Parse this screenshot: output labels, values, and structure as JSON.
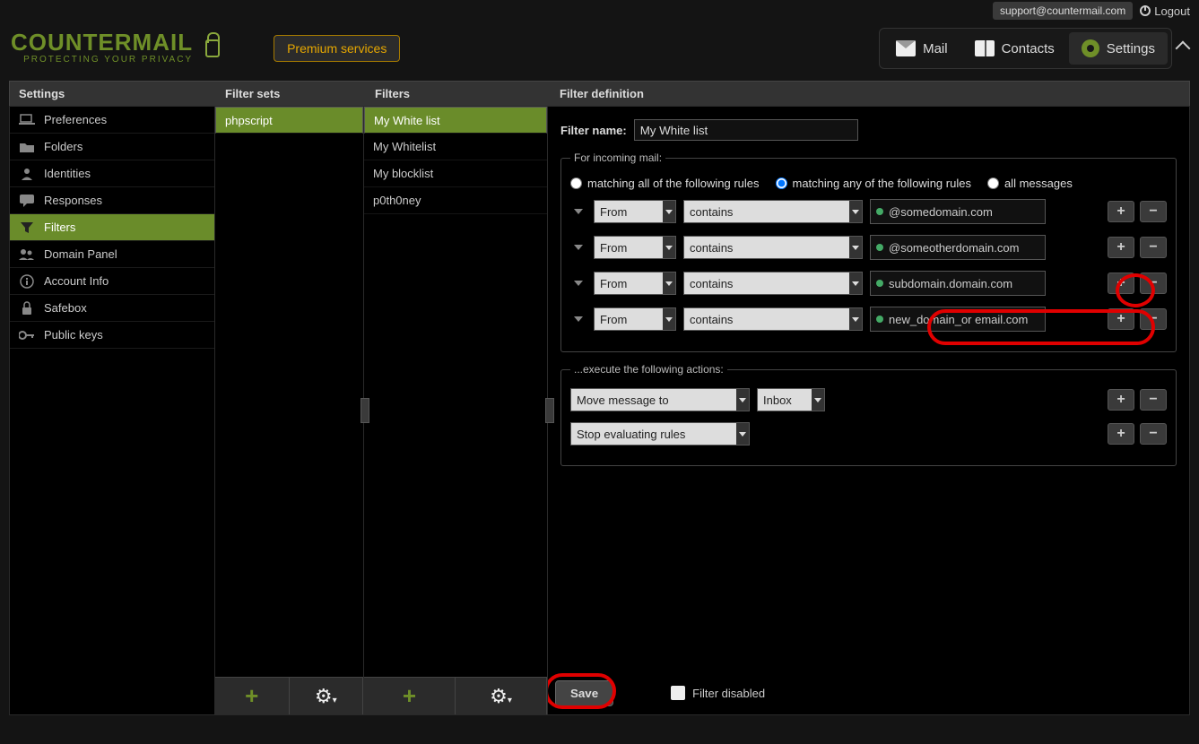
{
  "topbar": {
    "support": "support@countermail.com",
    "logout": "Logout"
  },
  "brand": {
    "name": "COUNTERMAIL",
    "tagline": "PROTECTING YOUR PRIVACY"
  },
  "premium_label": "Premium services",
  "tabs": {
    "mail": "Mail",
    "contacts": "Contacts",
    "settings": "Settings"
  },
  "columns": {
    "settings": "Settings",
    "filter_sets": "Filter sets",
    "filters": "Filters",
    "definition": "Filter definition"
  },
  "settings_menu": [
    {
      "label": "Preferences"
    },
    {
      "label": "Folders"
    },
    {
      "label": "Identities"
    },
    {
      "label": "Responses"
    },
    {
      "label": "Filters",
      "active": true
    },
    {
      "label": "Domain Panel"
    },
    {
      "label": "Account Info"
    },
    {
      "label": "Safebox"
    },
    {
      "label": "Public keys"
    }
  ],
  "filter_sets": [
    {
      "label": "phpscript",
      "active": true
    }
  ],
  "filters": [
    {
      "label": "My White list",
      "active": true
    },
    {
      "label": "My Whitelist"
    },
    {
      "label": "My blocklist"
    },
    {
      "label": "p0th0ney"
    }
  ],
  "form": {
    "name_label": "Filter name:",
    "name_value": "My White list",
    "rules_legend": "For incoming mail:",
    "match_all": "matching all of the following rules",
    "match_any": "matching any of the following rules",
    "match_allmsg": "all messages",
    "rules": [
      {
        "field": "From",
        "op": "contains",
        "value": "@somedomain.com"
      },
      {
        "field": "From",
        "op": "contains",
        "value": "@someotherdomain.com"
      },
      {
        "field": "From",
        "op": "contains",
        "value": "subdomain.domain.com"
      },
      {
        "field": "From",
        "op": "contains",
        "value": "new_domain_or email.com"
      }
    ],
    "actions_legend": "...execute the following actions:",
    "actions": [
      {
        "kind": "Move message to",
        "target": "Inbox"
      },
      {
        "kind": "Stop evaluating rules"
      }
    ],
    "save": "Save",
    "disabled_label": "Filter disabled"
  }
}
